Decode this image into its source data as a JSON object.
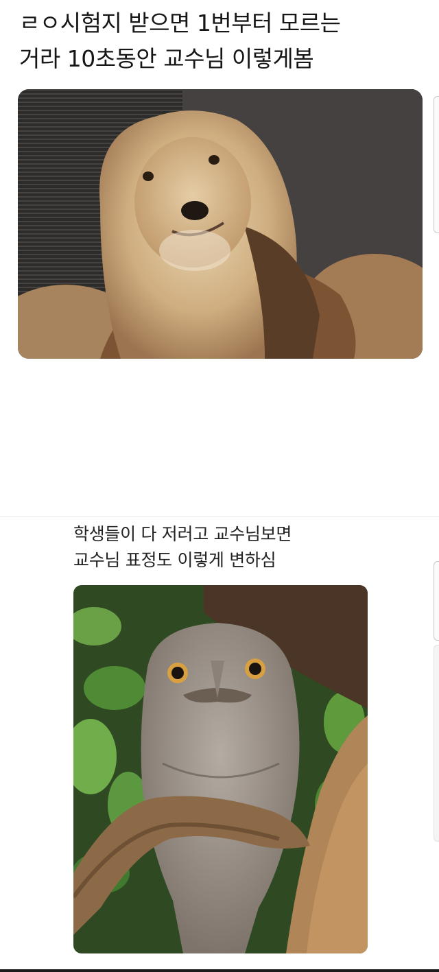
{
  "post1": {
    "title": "ㄹㅇ시험지 받으면 1번부터 모르는\n거라 10초동안 교수님 이렇게봄"
  },
  "post2": {
    "caption": "학생들이 다 저러고 교수님보면\n교수님 표정도 이렇게 변하심"
  },
  "colors": {
    "background": "#ffffff",
    "lion_backdrop": "#3d3a39",
    "lion_mane": "#d2b183",
    "owl_foliage": "#3f7a2e",
    "owl_feathers": "#9a9088"
  }
}
